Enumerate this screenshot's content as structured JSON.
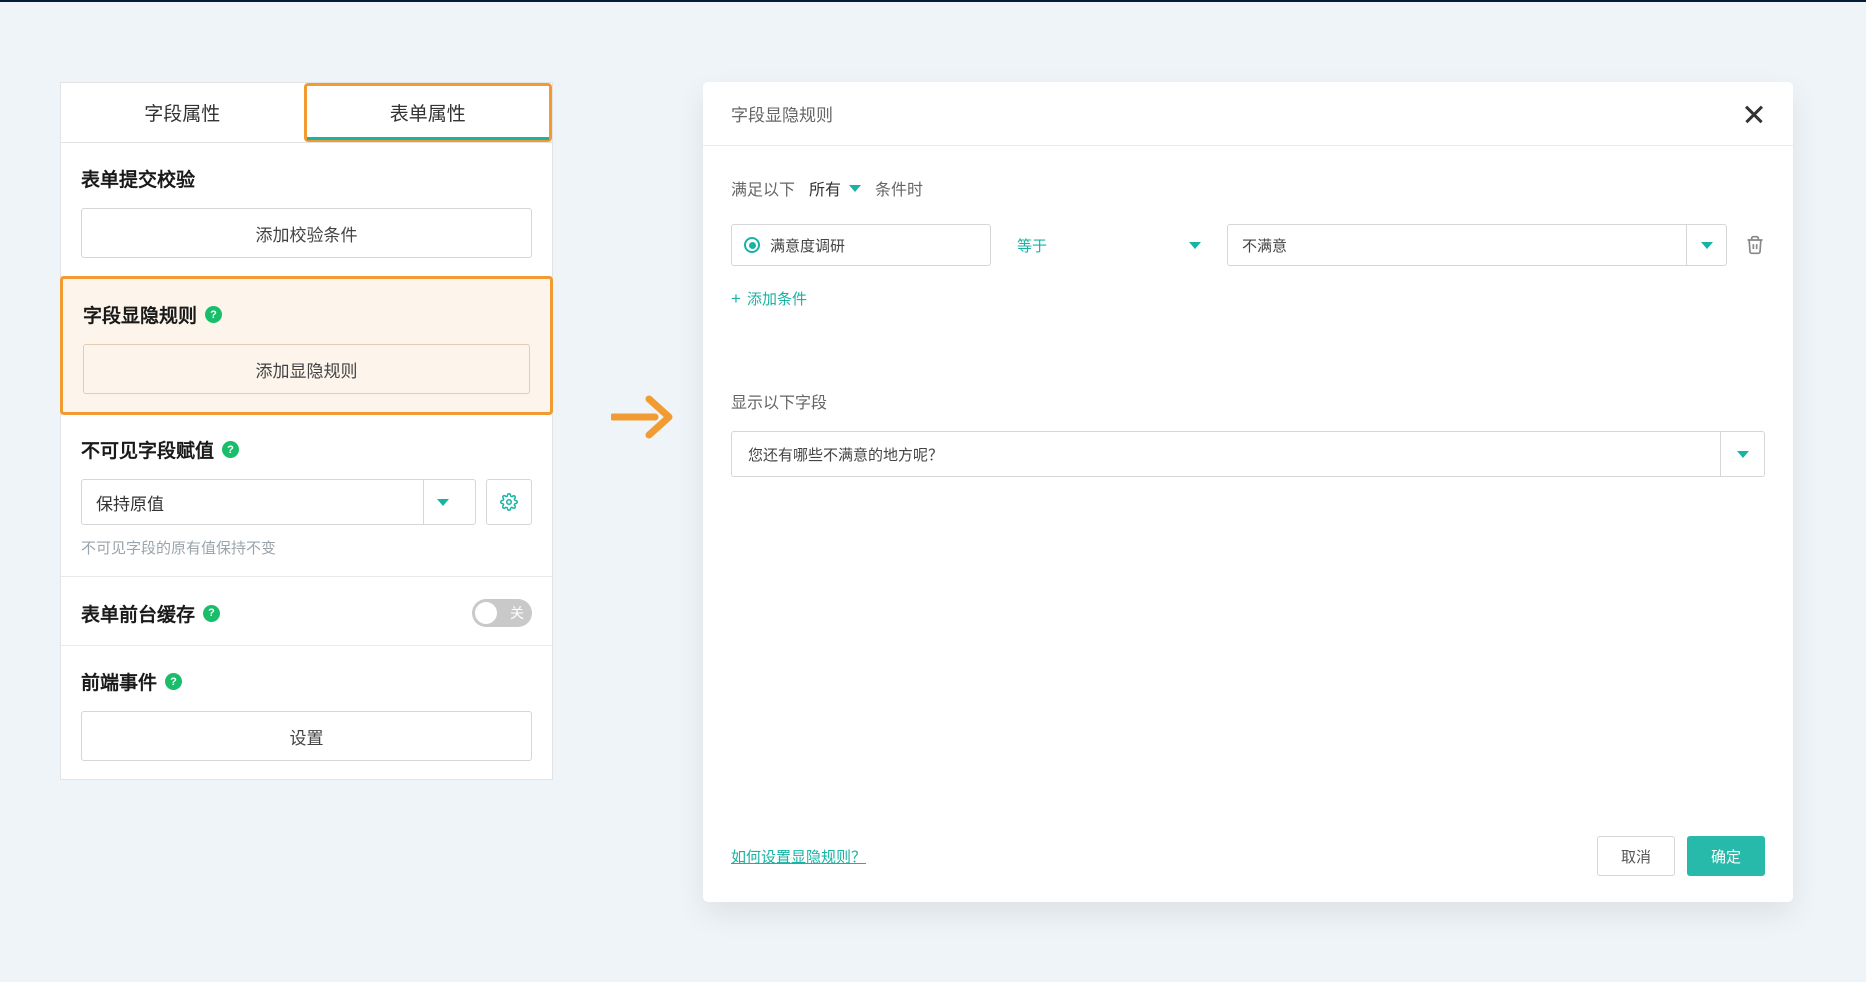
{
  "leftPanel": {
    "tabs": {
      "fieldProps": "字段属性",
      "formProps": "表单属性"
    },
    "sections": {
      "submitCheck": {
        "title": "表单提交校验",
        "button": "添加校验条件"
      },
      "visibilityRule": {
        "title": "字段显隐规则",
        "button": "添加显隐规则"
      },
      "hiddenAssign": {
        "title": "不可见字段赋值",
        "selectValue": "保持原值",
        "hint": "不可见字段的原有值保持不变"
      },
      "cache": {
        "title": "表单前台缓存",
        "toggleText": "关"
      },
      "frontendEvent": {
        "title": "前端事件",
        "button": "设置"
      }
    }
  },
  "modal": {
    "title": "字段显隐规则",
    "condition": {
      "prefix": "满足以下",
      "scope": "所有",
      "suffix": "条件时",
      "field": "满意度调研",
      "operator": "等于",
      "value": "不满意",
      "addLabel": "添加条件"
    },
    "show": {
      "label": "显示以下字段",
      "fieldValue": "您还有哪些不满意的地方呢？"
    },
    "helpLink": "如何设置显隐规则？",
    "cancel": "取消",
    "confirm": "确定"
  }
}
